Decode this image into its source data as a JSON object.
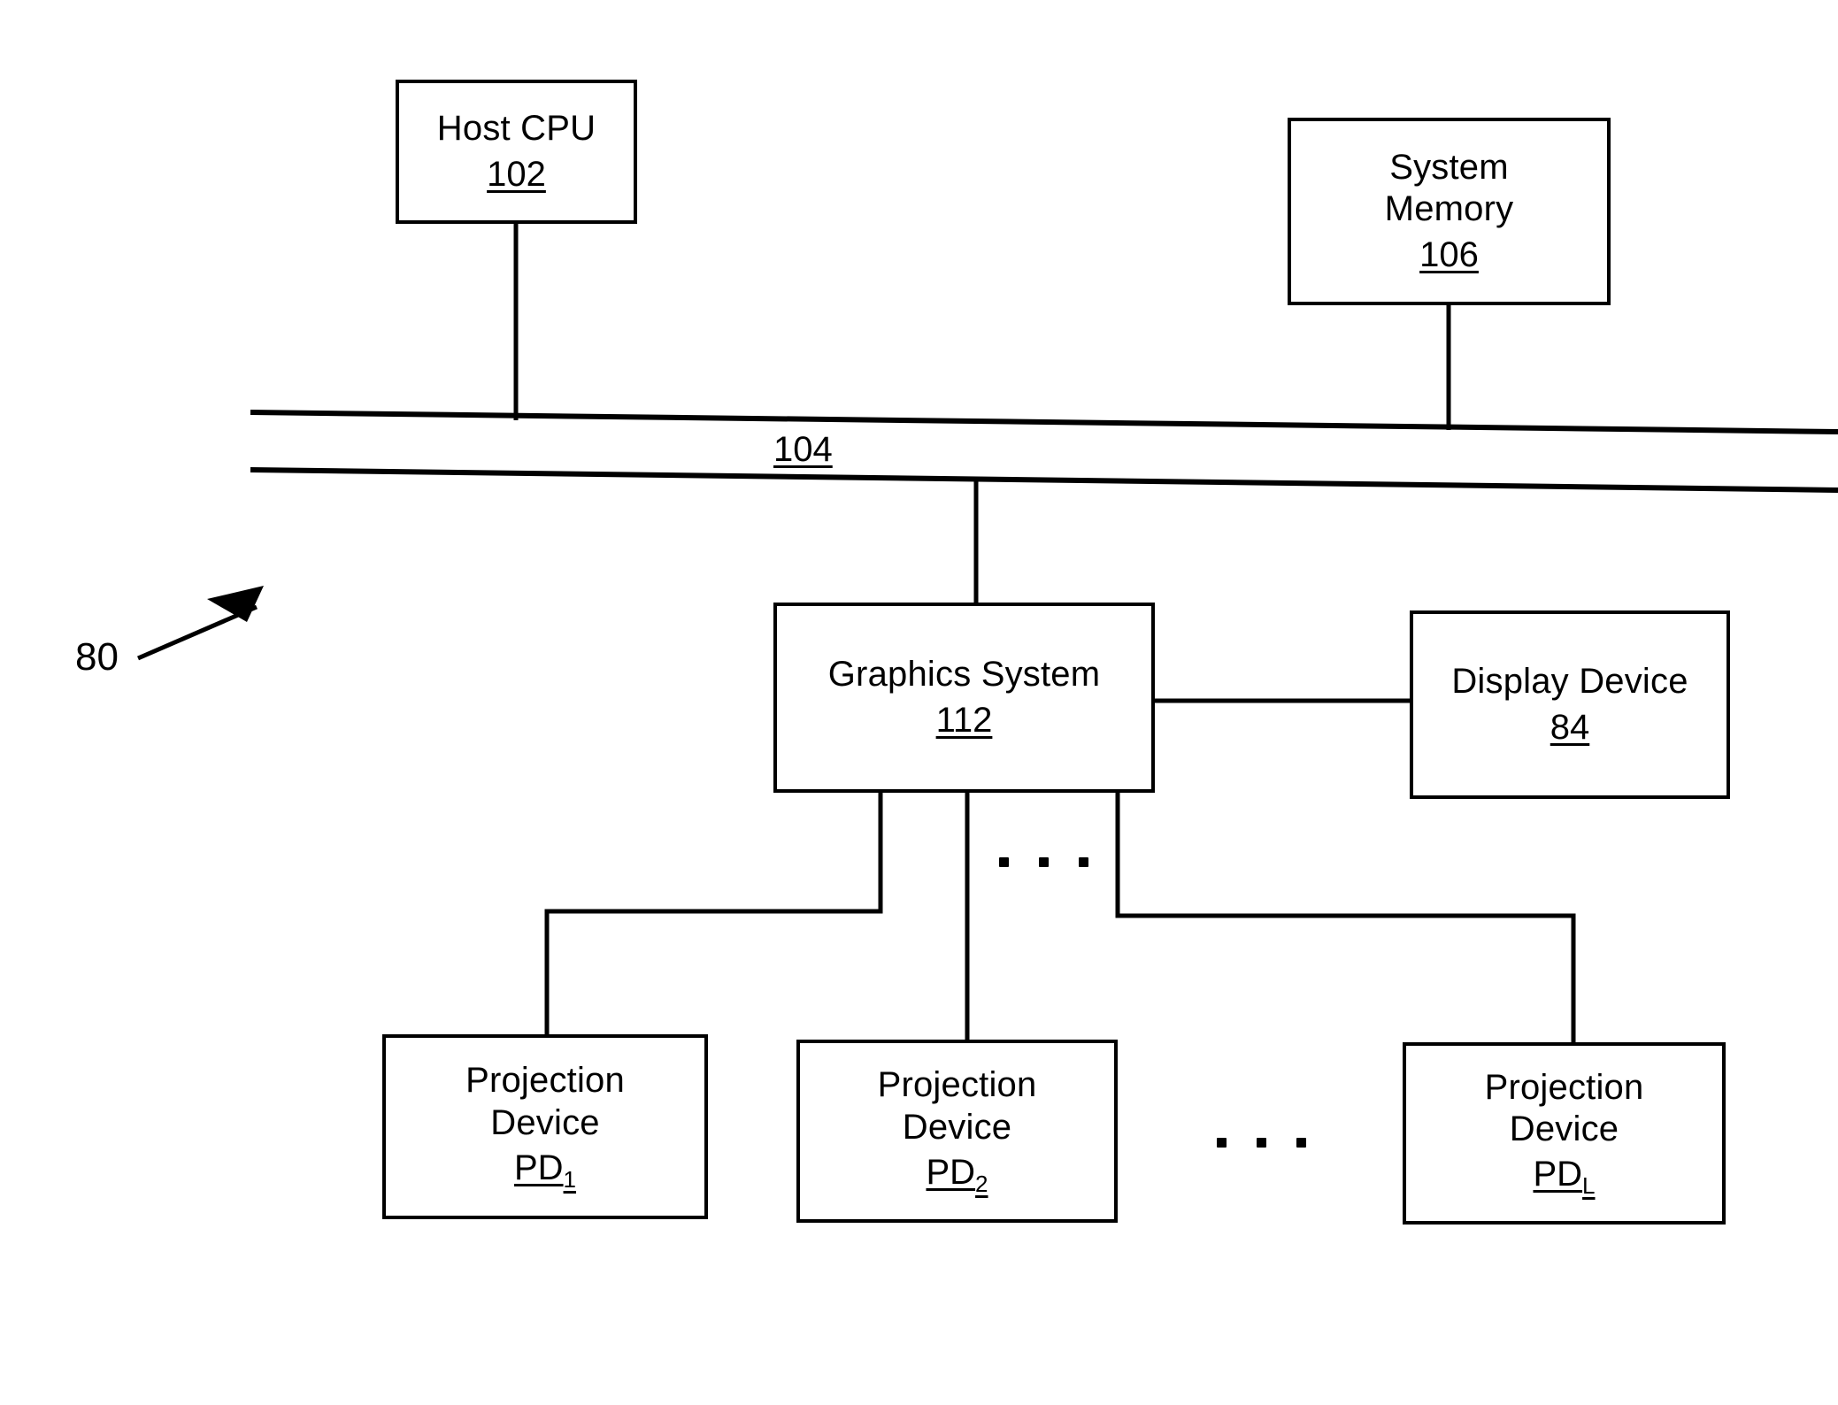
{
  "figure": {
    "reference_numeral": "80",
    "background_color": "#ffffff",
    "line_color": "#000000"
  },
  "nodes": {
    "host_cpu": {
      "title": "Host CPU",
      "ref": "102"
    },
    "system_memory": {
      "title": "System\nMemory",
      "ref": "106"
    },
    "graphics_system": {
      "title": "Graphics System",
      "ref": "112"
    },
    "display_device": {
      "title": "Display Device",
      "ref": "84"
    },
    "projection_device_1": {
      "title": "Projection\nDevice",
      "ref": "PD",
      "ref_subscript": "1"
    },
    "projection_device_2": {
      "title": "Projection\nDevice",
      "ref": "PD",
      "ref_subscript": "2"
    },
    "projection_device_l": {
      "title": "Projection\nDevice",
      "ref": "PD",
      "ref_subscript": "L"
    }
  },
  "bus": {
    "label": "104"
  },
  "ellipses": {
    "upper": "...",
    "lower": "..."
  }
}
